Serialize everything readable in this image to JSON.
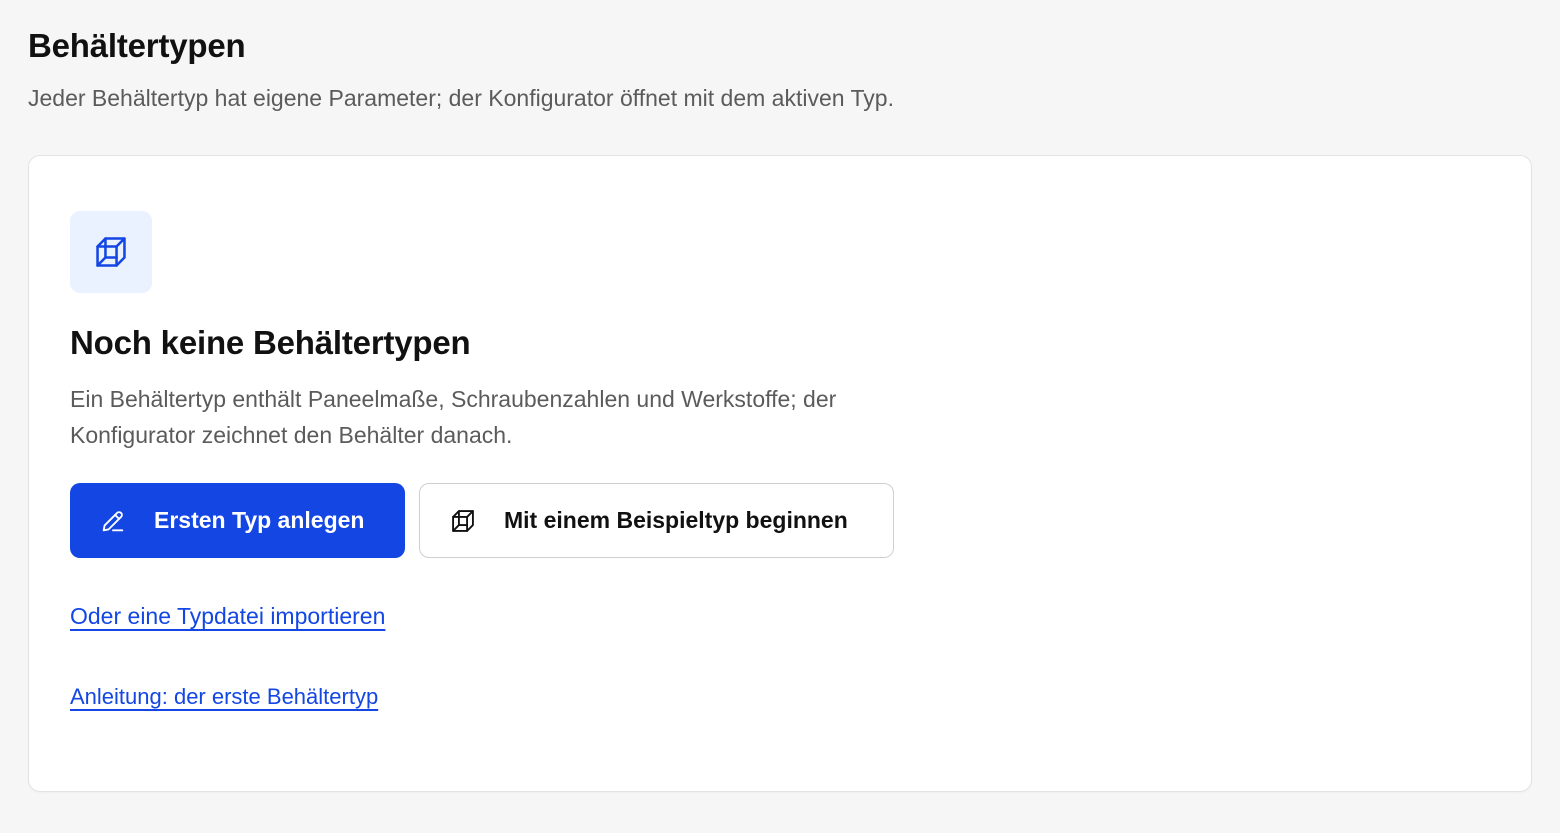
{
  "header": {
    "title": "Behältertypen",
    "subtitle": "Jeder Behältertyp hat eigene Parameter; der Konfigurator öffnet mit dem aktiven Typ."
  },
  "empty_state": {
    "icon": "box-icon",
    "title": "Noch keine Behältertypen",
    "description": "Ein Behältertyp enthält Paneelmaße, Schraubenzahlen und Werkstoffe; der Konfigurator zeichnet den Behälter danach.",
    "primary_action": {
      "label": "Ersten Typ anlegen",
      "icon": "pencil-icon"
    },
    "secondary_action": {
      "label": "Mit einem Beispieltyp beginnen",
      "icon": "box-icon"
    },
    "import_link": "Oder eine Typdatei importieren",
    "guide_link": "Anleitung: der erste Behältertyp"
  },
  "colors": {
    "accent": "#1346e3",
    "icon_tile_bg": "#eaf1ff",
    "page_bg": "#f6f6f6",
    "muted_text": "#5b5b5b"
  }
}
